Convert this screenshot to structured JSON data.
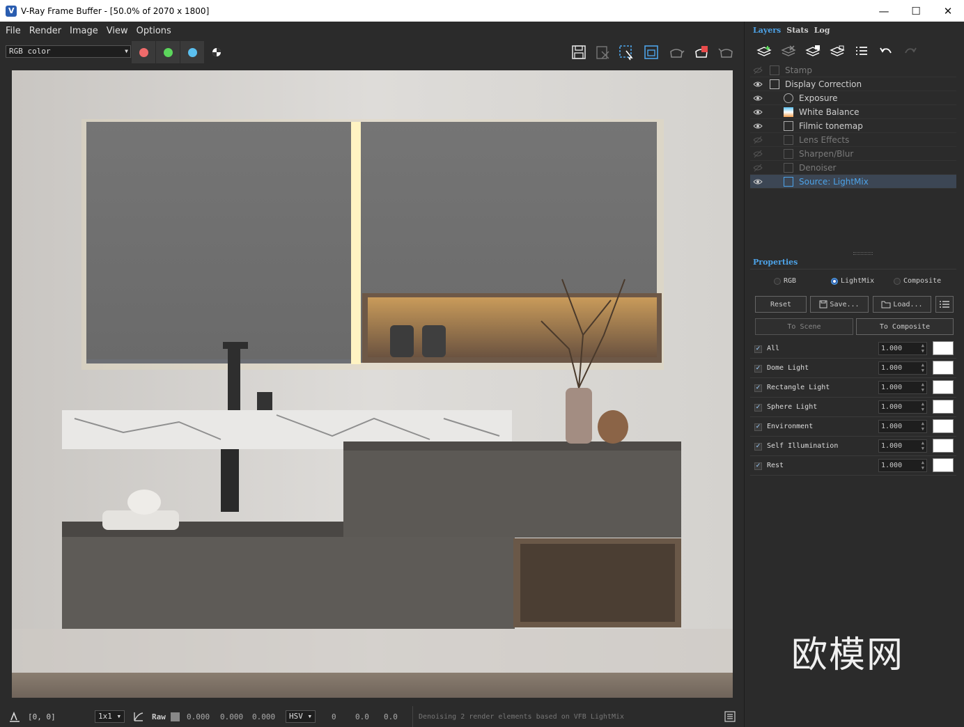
{
  "window": {
    "title": "V-Ray Frame Buffer - [50.0% of 2070 x 1800]",
    "minimize_glyph": "—",
    "maximize_glyph": "☐",
    "close_glyph": "✕"
  },
  "menu": [
    "File",
    "Render",
    "Image",
    "View",
    "Options"
  ],
  "toolbar": {
    "channel": "RGB color",
    "channel_buttons": [
      {
        "name": "red-channel",
        "color": "#ef6b6b"
      },
      {
        "name": "green-channel",
        "color": "#5cd65c"
      },
      {
        "name": "blue-channel",
        "color": "#5bc0f0"
      }
    ],
    "accent": "#4da3e8"
  },
  "status": {
    "coords": "[0, 0]",
    "sample_size": "1x1",
    "raw_label": "Raw",
    "raw_values": [
      "0.000",
      "0.000",
      "0.000"
    ],
    "color_mode": "HSV",
    "hsv_values": [
      "0",
      "0.0",
      "0.0"
    ],
    "message": "Denoising 2 render elements based on VFB LightMix"
  },
  "panel": {
    "tabs": [
      "Layers",
      "Stats",
      "Log"
    ],
    "layers": [
      {
        "label": "Stamp",
        "visible": false,
        "indent": 0
      },
      {
        "label": "Display Correction",
        "visible": true,
        "indent": 0
      },
      {
        "label": "Exposure",
        "visible": true,
        "indent": 1
      },
      {
        "label": "White Balance",
        "visible": true,
        "indent": 1
      },
      {
        "label": "Filmic tonemap",
        "visible": true,
        "indent": 1
      },
      {
        "label": "Lens Effects",
        "visible": false,
        "indent": 1
      },
      {
        "label": "Sharpen/Blur",
        "visible": false,
        "indent": 1
      },
      {
        "label": "Denoiser",
        "visible": false,
        "indent": 1
      },
      {
        "label": "Source: LightMix",
        "visible": true,
        "indent": 1,
        "selected": true
      }
    ],
    "properties_title": "Properties",
    "modes": [
      "RGB",
      "LightMix",
      "Composite"
    ],
    "selected_mode": "LightMix",
    "buttons": {
      "reset": "Reset",
      "save": "Save...",
      "load": "Load...",
      "to_scene": "To Scene",
      "to_composite": "To Composite"
    },
    "lightmix": [
      {
        "label": "All",
        "value": "1.000"
      },
      {
        "label": "Dome Light",
        "value": "1.000"
      },
      {
        "label": "Rectangle Light",
        "value": "1.000"
      },
      {
        "label": "Sphere Light",
        "value": "1.000"
      },
      {
        "label": "Environment",
        "value": "1.000"
      },
      {
        "label": "Self Illumination",
        "value": "1.000"
      },
      {
        "label": "Rest",
        "value": "1.000"
      }
    ]
  },
  "watermark": {
    "logo_text": "欧模网"
  }
}
